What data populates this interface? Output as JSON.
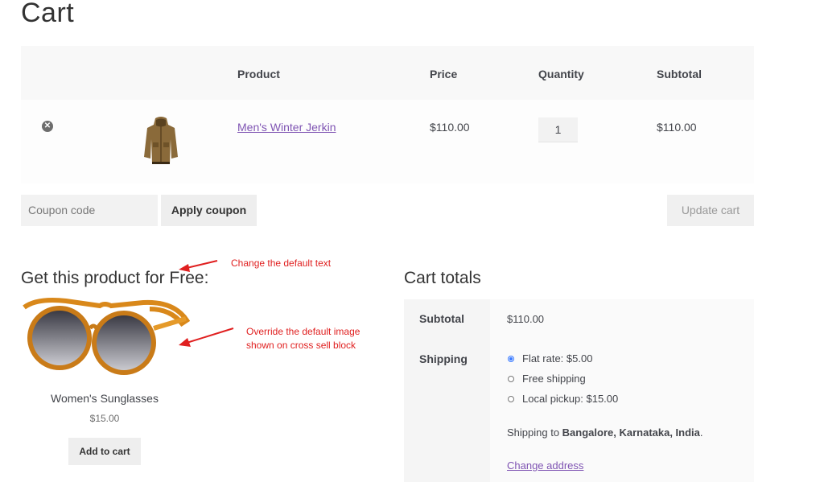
{
  "page": {
    "title": "Cart"
  },
  "cart_table": {
    "headers": {
      "product": "Product",
      "price": "Price",
      "quantity": "Quantity",
      "subtotal": "Subtotal"
    },
    "rows": [
      {
        "remove_icon": "remove-circle-icon",
        "product_name": "Men's Winter Jerkin",
        "price": "$110.00",
        "quantity": "1",
        "subtotal": "$110.00"
      }
    ]
  },
  "actions": {
    "coupon_placeholder": "Coupon code",
    "apply_coupon": "Apply coupon",
    "update_cart": "Update cart"
  },
  "cross_sell": {
    "heading": "Get this product for Free:",
    "product_name": "Women's Sunglasses",
    "price": "$15.00",
    "add_to_cart": "Add to cart"
  },
  "annotations": {
    "note1": "Change the default text",
    "note2_line1": "Override the default image",
    "note2_line2": "shown on cross sell block"
  },
  "cart_totals": {
    "heading": "Cart totals",
    "subtotal_label": "Subtotal",
    "subtotal_value": "$110.00",
    "shipping_label": "Shipping",
    "shipping_options": [
      {
        "label": "Flat rate: $5.00",
        "selected": true
      },
      {
        "label": "Free shipping",
        "selected": false
      },
      {
        "label": "Local pickup: $15.00",
        "selected": false
      }
    ],
    "shipping_to_prefix": "Shipping to ",
    "shipping_to_location": "Bangalore, Karnataka, India",
    "shipping_to_suffix": ".",
    "change_address": "Change address"
  },
  "colors": {
    "link": "#7f54b3",
    "annotation": "#e02020",
    "radio_selected": "#3b7bff"
  }
}
